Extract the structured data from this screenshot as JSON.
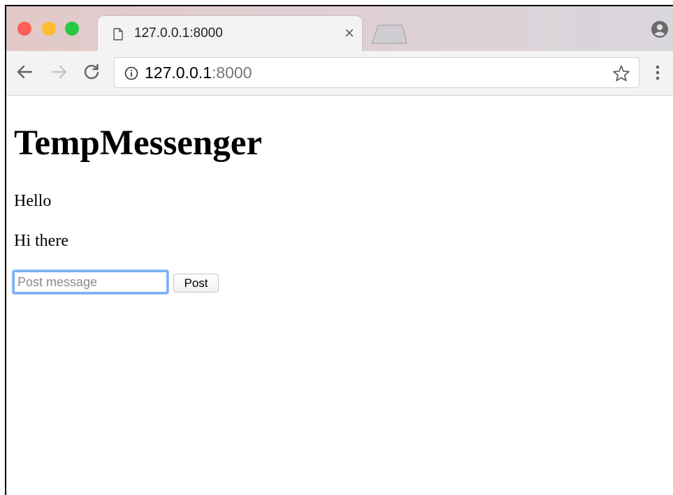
{
  "browser": {
    "tab": {
      "title": "127.0.0.1:8000",
      "close_glyph": "×"
    },
    "address_bar": {
      "host": "127.0.0.1",
      "port": ":8000"
    },
    "icons": {
      "tab_icon": "document-icon",
      "back": "arrow-left-icon",
      "forward": "arrow-right-icon",
      "reload": "reload-icon",
      "info": "info-icon",
      "bookmark": "star-icon",
      "menu": "more-vertical-icon",
      "profile": "profile-icon"
    },
    "colors": {
      "close": "#fe5f57",
      "minimize": "#febc2e",
      "zoom": "#28c840",
      "input_focus": "#7ab1f4"
    }
  },
  "page": {
    "title": "TempMessenger",
    "messages": [
      {
        "text": "Hello"
      },
      {
        "text": "Hi there"
      }
    ],
    "form": {
      "input_placeholder": "Post message",
      "input_value": "",
      "button_label": "Post"
    }
  }
}
